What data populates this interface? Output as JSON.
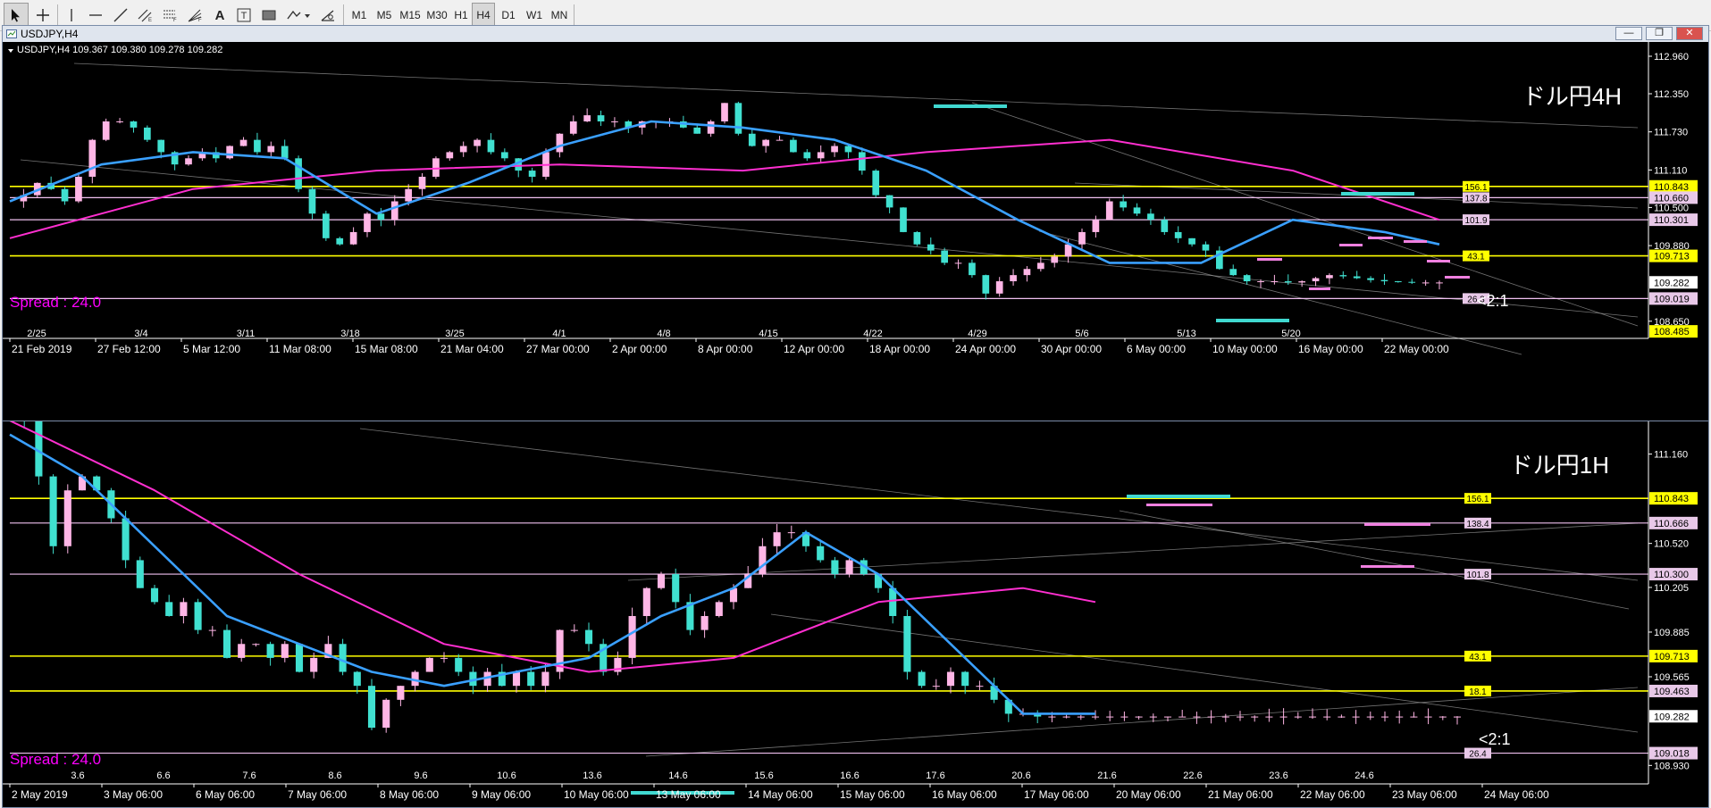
{
  "toolbar": {
    "timeframes": [
      "M1",
      "M5",
      "M15",
      "M30",
      "H1",
      "H4",
      "D1",
      "W1",
      "MN"
    ],
    "active_timeframe": "H4",
    "tools": [
      "cursor-icon",
      "crosshair-icon",
      "vertical-line-icon",
      "horizontal-line-icon",
      "trendline-icon",
      "equidistant-channel-icon",
      "fibonacci-retracement-icon",
      "fibonacci-fan-icon",
      "text-icon",
      "text-label-icon",
      "rectangle-icon",
      "shapes-dropdown-icon",
      "settings-icon"
    ],
    "text_tool_label": "A",
    "label_tool_label": "T"
  },
  "colors": {
    "background": "#000000",
    "candle_up": "#ffb6e6",
    "candle_down": "#40e0d0",
    "ma_fast": "#3aa0ff",
    "ma_slow": "#ff2fd0",
    "level_yellow": "#ffff00",
    "level_pink": "#f0c0f0",
    "cyan_marker": "#40d8d0",
    "pink_marker": "#f080e0",
    "spread_text": "#ff00ff"
  },
  "chart_top": {
    "window_title": "USDJPY,H4",
    "info_line": "USDJPY,H4  109.367 109.380 109.278 109.282",
    "watermark": "ドル円4H",
    "spread_label": "Spread : 24.0",
    "ratio_label": "<2:1",
    "fib_labels": [
      "156.1",
      "137.8",
      "101.9",
      "43.1",
      "26.3"
    ],
    "buttons": {
      "minimize": "—",
      "restore": "❐",
      "close": "✕"
    }
  },
  "chart_bottom": {
    "watermark": "ドル円1H",
    "spread_label": "Spread : 24.0",
    "ratio_label": "<2:1",
    "fib_labels": [
      "156.1",
      "138.4",
      "101.8",
      "43.1",
      "18.1",
      "26.4"
    ]
  },
  "chart_data": [
    {
      "type": "line",
      "title": "USDJPY,H4",
      "symbol": "USDJPY",
      "timeframe": "H4",
      "ohlc_last": {
        "open": 109.367,
        "high": 109.38,
        "low": 109.278,
        "close": 109.282
      },
      "ylim": [
        108.4,
        112.96
      ],
      "y_ticks": [
        "112.960",
        "112.350",
        "111.730",
        "111.110",
        "110.843",
        "110.660",
        "110.500",
        "110.301",
        "109.880",
        "109.713",
        "109.282",
        "109.019",
        "108.650",
        "108.485"
      ],
      "x_ticks": [
        "21 Feb 2019",
        "27 Feb 12:00",
        "5 Mar 12:00",
        "11 Mar 08:00",
        "15 Mar 08:00",
        "21 Mar 04:00",
        "27 Mar 00:00",
        "2 Apr 00:00",
        "8 Apr 00:00",
        "12 Apr 00:00",
        "18 Apr 00:00",
        "24 Apr 00:00",
        "30 Apr 00:00",
        "6 May 00:00",
        "10 May 00:00",
        "16 May 00:00",
        "22 May 00:00"
      ],
      "period_separators": [
        "2/25",
        "3/4",
        "3/11",
        "3/18",
        "3/25",
        "4/1",
        "4/8",
        "4/15",
        "4/22",
        "4/29",
        "5/6",
        "5/13",
        "5/20"
      ],
      "price_tags": [
        {
          "price": "110.843",
          "kind": "yellow"
        },
        {
          "price": "110.660",
          "kind": "pink"
        },
        {
          "price": "110.301",
          "kind": "pink"
        },
        {
          "price": "109.713",
          "kind": "yellow"
        },
        {
          "price": "109.282",
          "kind": "white"
        },
        {
          "price": "109.019",
          "kind": "pink"
        },
        {
          "price": "108.485",
          "kind": "yellow"
        }
      ],
      "levels": [
        {
          "price": 110.843,
          "label": "156.1",
          "color": "yellow"
        },
        {
          "price": 110.66,
          "label": "137.8",
          "color": "pink"
        },
        {
          "price": 110.301,
          "label": "101.9",
          "color": "pink"
        },
        {
          "price": 109.713,
          "label": "43.1",
          "color": "yellow"
        },
        {
          "price": 109.019,
          "label": "26.3",
          "color": "pink"
        }
      ],
      "series": [
        {
          "name": "close",
          "x": [
            0,
            3,
            6,
            9,
            12,
            15,
            18,
            21,
            24,
            27,
            30,
            33,
            36,
            39,
            42,
            45,
            48,
            51,
            54,
            57,
            60,
            63,
            66,
            69,
            72,
            75,
            78,
            81,
            84,
            87,
            90,
            93,
            96,
            99,
            102,
            105,
            108,
            111,
            114,
            117,
            120,
            123,
            126,
            129,
            132,
            135,
            138,
            141,
            144,
            147,
            150,
            153,
            156,
            159,
            162,
            165,
            168,
            171,
            174,
            177,
            180,
            183,
            186,
            189,
            192,
            195,
            198,
            201,
            204,
            207,
            210,
            213,
            216,
            219,
            222,
            225,
            228,
            231,
            234,
            237,
            240,
            243,
            246,
            249,
            252,
            255,
            258,
            261,
            264,
            267,
            270,
            273,
            276,
            279,
            282,
            285,
            288,
            291,
            294,
            297,
            300,
            303,
            306,
            309,
            312
          ],
          "values": [
            110.6,
            110.7,
            110.9,
            110.8,
            110.6,
            111.0,
            111.6,
            111.9,
            111.9,
            111.8,
            111.6,
            111.4,
            111.2,
            111.3,
            111.4,
            111.3,
            111.5,
            111.6,
            111.4,
            111.5,
            111.3,
            110.8,
            110.4,
            110.0,
            109.9,
            110.1,
            110.4,
            110.3,
            110.6,
            110.8,
            111.0,
            111.3,
            111.4,
            111.5,
            111.6,
            111.4,
            111.3,
            111.1,
            111.0,
            111.4,
            111.7,
            111.9,
            112.0,
            111.9,
            111.9,
            111.8,
            111.9,
            111.9,
            111.9,
            111.8,
            111.7,
            111.9,
            112.2,
            111.7,
            111.5,
            111.6,
            111.6,
            111.4,
            111.3,
            111.4,
            111.5,
            111.4,
            111.1,
            110.7,
            110.5,
            110.1,
            109.9,
            109.8,
            109.6,
            109.6,
            109.4,
            109.1,
            109.3,
            109.4,
            109.5,
            109.6,
            109.7,
            109.9,
            110.1,
            110.3,
            110.6,
            110.5,
            110.4,
            110.3,
            110.1,
            110.0,
            109.9,
            109.8,
            109.5,
            109.4,
            109.3,
            109.3,
            109.3,
            109.28,
            109.3,
            109.35,
            109.4,
            109.38,
            109.35,
            109.32,
            109.3,
            109.29,
            109.28,
            109.28,
            109.28
          ]
        },
        {
          "name": "ma_fast",
          "x": [
            0,
            20,
            40,
            60,
            80,
            100,
            120,
            140,
            160,
            180,
            200,
            220,
            240,
            260,
            280,
            300,
            312
          ],
          "values": [
            110.6,
            111.2,
            111.4,
            111.3,
            110.4,
            110.9,
            111.5,
            111.9,
            111.8,
            111.6,
            111.1,
            110.3,
            109.6,
            109.6,
            110.3,
            110.1,
            109.9
          ]
        },
        {
          "name": "ma_slow",
          "x": [
            0,
            40,
            80,
            120,
            160,
            200,
            240,
            280,
            312
          ],
          "values": [
            110.0,
            110.8,
            111.1,
            111.2,
            111.1,
            111.4,
            111.6,
            111.1,
            110.3
          ]
        }
      ]
    },
    {
      "type": "line",
      "title": "USDJPY,H1",
      "symbol": "USDJPY",
      "timeframe": "H1",
      "ylim": [
        108.9,
        111.33
      ],
      "y_ticks": [
        "111.160",
        "110.843",
        "110.666",
        "110.520",
        "110.300",
        "110.205",
        "109.885",
        "109.713",
        "109.565",
        "109.463",
        "109.282",
        "109.018",
        "108.930"
      ],
      "x_ticks": [
        "2 May 2019",
        "3 May 06:00",
        "6 May 06:00",
        "7 May 06:00",
        "8 May 06:00",
        "9 May 06:00",
        "10 May 06:00",
        "13 May 06:00",
        "14 May 06:00",
        "15 May 06:00",
        "16 May 06:00",
        "17 May 06:00",
        "20 May 06:00",
        "21 May 06:00",
        "22 May 06:00",
        "23 May 06:00",
        "24 May 06:00"
      ],
      "period_separators": [
        "3.6",
        "6.6",
        "7.6",
        "8.6",
        "9.6",
        "10.6",
        "13.6",
        "14.6",
        "15.6",
        "16.6",
        "17.6",
        "20.6",
        "21.6",
        "22.6",
        "23.6",
        "24.6"
      ],
      "price_tags": [
        {
          "price": "110.843",
          "kind": "yellow"
        },
        {
          "price": "110.666",
          "kind": "pink"
        },
        {
          "price": "110.300",
          "kind": "pink"
        },
        {
          "price": "109.713",
          "kind": "yellow"
        },
        {
          "price": "109.463",
          "kind": "pink"
        },
        {
          "price": "109.282",
          "kind": "white"
        },
        {
          "price": "109.018",
          "kind": "pink"
        }
      ],
      "levels": [
        {
          "price": 110.843,
          "label": "156.1",
          "color": "yellow"
        },
        {
          "price": 110.666,
          "label": "138.4",
          "color": "pink"
        },
        {
          "price": 110.3,
          "label": "101.8",
          "color": "pink"
        },
        {
          "price": 109.713,
          "label": "43.1",
          "color": "yellow"
        },
        {
          "price": 109.463,
          "label": "18.1",
          "color": "yellow"
        },
        {
          "price": 109.018,
          "label": "26.4",
          "color": "pink"
        }
      ],
      "series": [
        {
          "name": "close",
          "x": [
            0,
            4,
            8,
            12,
            16,
            20,
            24,
            28,
            32,
            36,
            40,
            44,
            48,
            52,
            56,
            60,
            64,
            68,
            72,
            76,
            80,
            84,
            88,
            92,
            96,
            100,
            104,
            108,
            112,
            116,
            120,
            124,
            128,
            132,
            136,
            140,
            144,
            148,
            152,
            156,
            160,
            164,
            168,
            172,
            176,
            180,
            184,
            188,
            192,
            196,
            200,
            204,
            208,
            212,
            216,
            220,
            224,
            228,
            232,
            236,
            240,
            244,
            248,
            252,
            256,
            260,
            264,
            268,
            272,
            276,
            280,
            284,
            288,
            292,
            296,
            300,
            304,
            308,
            312,
            316,
            320,
            324,
            328,
            332,
            336,
            340,
            344,
            348,
            352,
            356,
            360,
            364,
            368,
            372,
            376,
            380,
            384,
            388,
            392,
            396,
            400
          ],
          "values": [
            111.6,
            111.4,
            111.0,
            110.5,
            110.9,
            111.0,
            110.9,
            110.7,
            110.4,
            110.2,
            110.1,
            110.0,
            110.1,
            109.9,
            109.9,
            109.7,
            109.8,
            109.8,
            109.7,
            109.8,
            109.6,
            109.7,
            109.8,
            109.6,
            109.5,
            109.2,
            109.4,
            109.5,
            109.6,
            109.7,
            109.7,
            109.6,
            109.5,
            109.6,
            109.5,
            109.6,
            109.5,
            109.6,
            109.9,
            109.9,
            109.8,
            109.6,
            109.7,
            110.0,
            110.2,
            110.3,
            110.1,
            109.9,
            110.0,
            110.1,
            110.2,
            110.3,
            110.5,
            110.6,
            110.6,
            110.5,
            110.4,
            110.3,
            110.4,
            110.3,
            110.2,
            110.0,
            109.6,
            109.5,
            109.5,
            109.6,
            109.5,
            109.5,
            109.4,
            109.3,
            109.3,
            109.28,
            109.28,
            109.28,
            109.28,
            109.28,
            109.28,
            109.28,
            109.28,
            109.28,
            109.28,
            109.28,
            109.28,
            109.28,
            109.28,
            109.28,
            109.28,
            109.28,
            109.28,
            109.28,
            109.28,
            109.28,
            109.28,
            109.28,
            109.28,
            109.28,
            109.28,
            109.28,
            109.28,
            109.28,
            109.28
          ]
        },
        {
          "name": "ma_fast",
          "x": [
            0,
            20,
            40,
            60,
            80,
            100,
            120,
            140,
            160,
            180,
            200,
            220,
            240,
            260,
            280,
            300
          ],
          "values": [
            111.3,
            111.0,
            110.5,
            110.0,
            109.8,
            109.6,
            109.5,
            109.6,
            109.7,
            110.0,
            110.2,
            110.6,
            110.3,
            109.8,
            109.3,
            109.3
          ]
        },
        {
          "name": "ma_slow",
          "x": [
            0,
            40,
            80,
            120,
            160,
            200,
            240,
            280,
            300
          ],
          "values": [
            111.4,
            110.9,
            110.3,
            109.8,
            109.6,
            109.7,
            110.1,
            110.2,
            110.1
          ]
        }
      ]
    }
  ]
}
